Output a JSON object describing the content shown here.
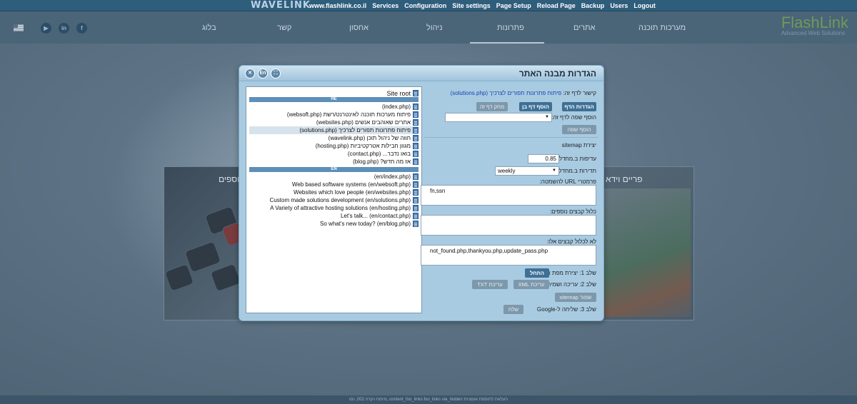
{
  "admin_bar": {
    "logo": "WAVELINK",
    "menu": [
      "www.flashlink.co.il",
      "Services",
      "Configuration",
      "Site settings",
      "Page Setup",
      "Reload Page",
      "Backup",
      "Users",
      "Logout"
    ]
  },
  "header": {
    "social": [
      "US flag",
      "youtube-icon",
      "linkedin-icon",
      "facebook-icon"
    ],
    "nav": [
      "בלוג",
      "קשר",
      "אחסון",
      "ניהול",
      "פתרונות",
      "אתרים",
      "מערכות תוכנה"
    ],
    "active_nav": "פתרונות",
    "brand_name": "FlashLink",
    "brand_tagline": "Advanced Web Solutions"
  },
  "slider": {
    "label_left": "נוספים",
    "label_right": "פריים וידא"
  },
  "footer": {
    "text": "פיתוח ויקרה 002, נסו, content_foo_links foo_links via_hidden העלאת לתוספת אופציות"
  },
  "dialog": {
    "title": "הגדרות מבנה האתר",
    "controls": [
      "close-icon",
      "En",
      "fullscreen-icon"
    ],
    "tree": {
      "root": "Site root",
      "he_label": "HE",
      "he_items": [
        "(index.php)",
        "פיתוח מערכות תוכנה לאינטרנט/רשת (websoft.php)",
        "אתרים שאוהבים אנשים (websites.php)",
        "פיתוח פתרונות תפורים לצרכיך (solutions.php)",
        "חווה של ניהול תוכן (wavelink.php)",
        "מגוון חבילות אטרקטיביות (hosting.php)",
        "בואו נדבר... (contact.php)",
        "אז מה חדש? (blog.php)"
      ],
      "en_label": "EN",
      "en_items": [
        "(en/index.php)",
        "Web based software systems (en/websoft.php)",
        "Websites which love people (en/websites.php)",
        "Custom made solutions development (en/solutions.php)",
        "A Variety of attractive hosting solutions (en/hosting.php)",
        "Let's talk... (en/contact.php)",
        "So what's new today? (en/blog.php)"
      ],
      "selected_index": 3
    },
    "form": {
      "link_label": "קישור לדף זה:",
      "link_value": "פיתוח פתרונות תפורים לצרכיך (solutions.php)",
      "btn_page_settings": "הגדרות הדף",
      "btn_add_child": "הוסף דף בן",
      "btn_delete_page": "מחק דף זה",
      "add_lang_label": "הוסף שפה לדף זה:",
      "add_lang_value": "",
      "btn_add_lang": "הוסף שפה",
      "sitemap_heading": "יצירת sitemap",
      "priority_label": "עדיפות ב.מחדל:",
      "priority_value": "0.85",
      "freq_label": "תדירות ב.מחדל:",
      "freq_value": "weekly",
      "ignore_url_label": "פרמטרי URL להשמטה:",
      "ignore_url_value": "fn,ssn",
      "include_label": "כלול קבצים נוספים:",
      "include_value": "",
      "exclude_label": "לא לכלול קבצים אלו:",
      "exclude_value": "not_found.php,thankyou.php,update_pass.php",
      "step1_label": "שלב 1: יצירת מפת אתר",
      "btn_start": "התחל",
      "step2_label": "שלב 2: עריכה ושמירה",
      "btn_edit_xml": "עריכת XML",
      "btn_edit_txt": "עריכת TXT",
      "btn_save_sitemap": "שמור sitemap",
      "step3_label": "שלב 3: שליחה ל-Google",
      "btn_send": "שלח"
    }
  }
}
